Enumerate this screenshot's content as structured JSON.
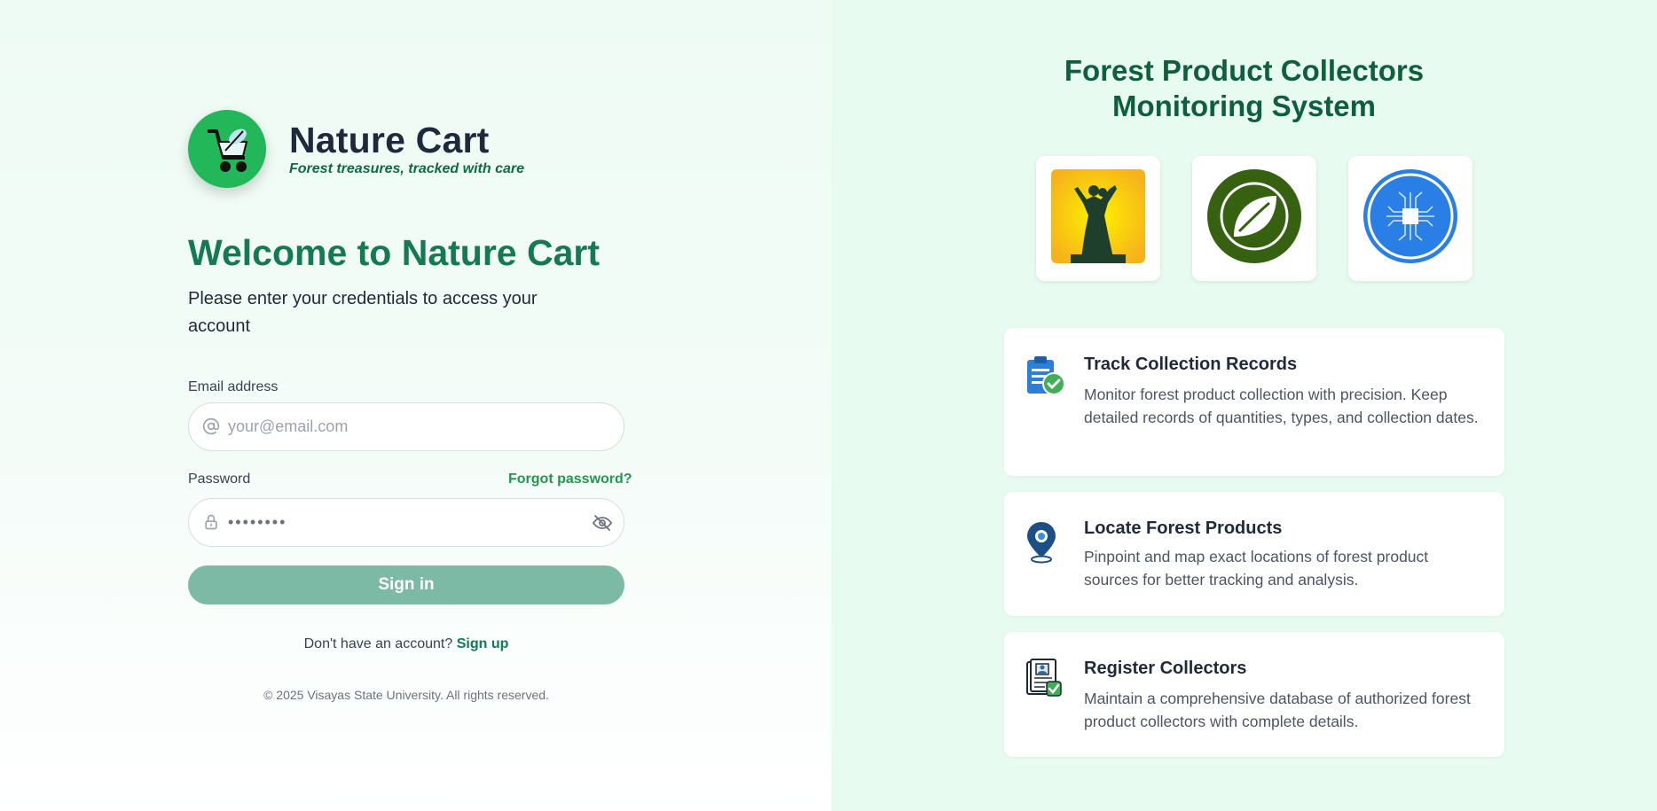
{
  "brand": {
    "name": "Nature Cart",
    "tagline": "Forest treasures, tracked with care"
  },
  "login": {
    "welcome": "Welcome to Nature Cart",
    "subtitle": "Please enter your credentials to access your account",
    "email_label": "Email address",
    "email_placeholder": "your@email.com",
    "password_label": "Password",
    "password_value": "••••••••",
    "forgot_link": "Forgot password?",
    "signin_button": "Sign in",
    "no_account_text": "Don't have an account?",
    "signup_link": "Sign up",
    "copyright": "© 2025 Visayas State University. All rights reserved."
  },
  "panel": {
    "title_line1": "Forest Product Collectors",
    "title_line2": "Monitoring System",
    "badges": [
      {
        "icon": "statue-logo-icon"
      },
      {
        "icon": "leaf-logo-icon"
      },
      {
        "icon": "circuit-chip-logo-icon"
      }
    ],
    "features": [
      {
        "icon": "clipboard-check-icon",
        "title": "Track Collection Records",
        "description": "Monitor forest product collection with precision. Keep detailed records of quantities, types, and collection dates."
      },
      {
        "icon": "map-pin-icon",
        "title": "Locate Forest Products",
        "description": "Pinpoint and map exact locations of forest product sources for better tracking and analysis."
      },
      {
        "icon": "id-document-check-icon",
        "title": "Register Collectors",
        "description": "Maintain a comprehensive database of authorized forest product collectors with complete details."
      }
    ]
  },
  "colors": {
    "primary": "#137a55",
    "button_disabled": "#7dbaa5",
    "link": "#1e9a4c",
    "right_bg": "#e8fbf1"
  }
}
